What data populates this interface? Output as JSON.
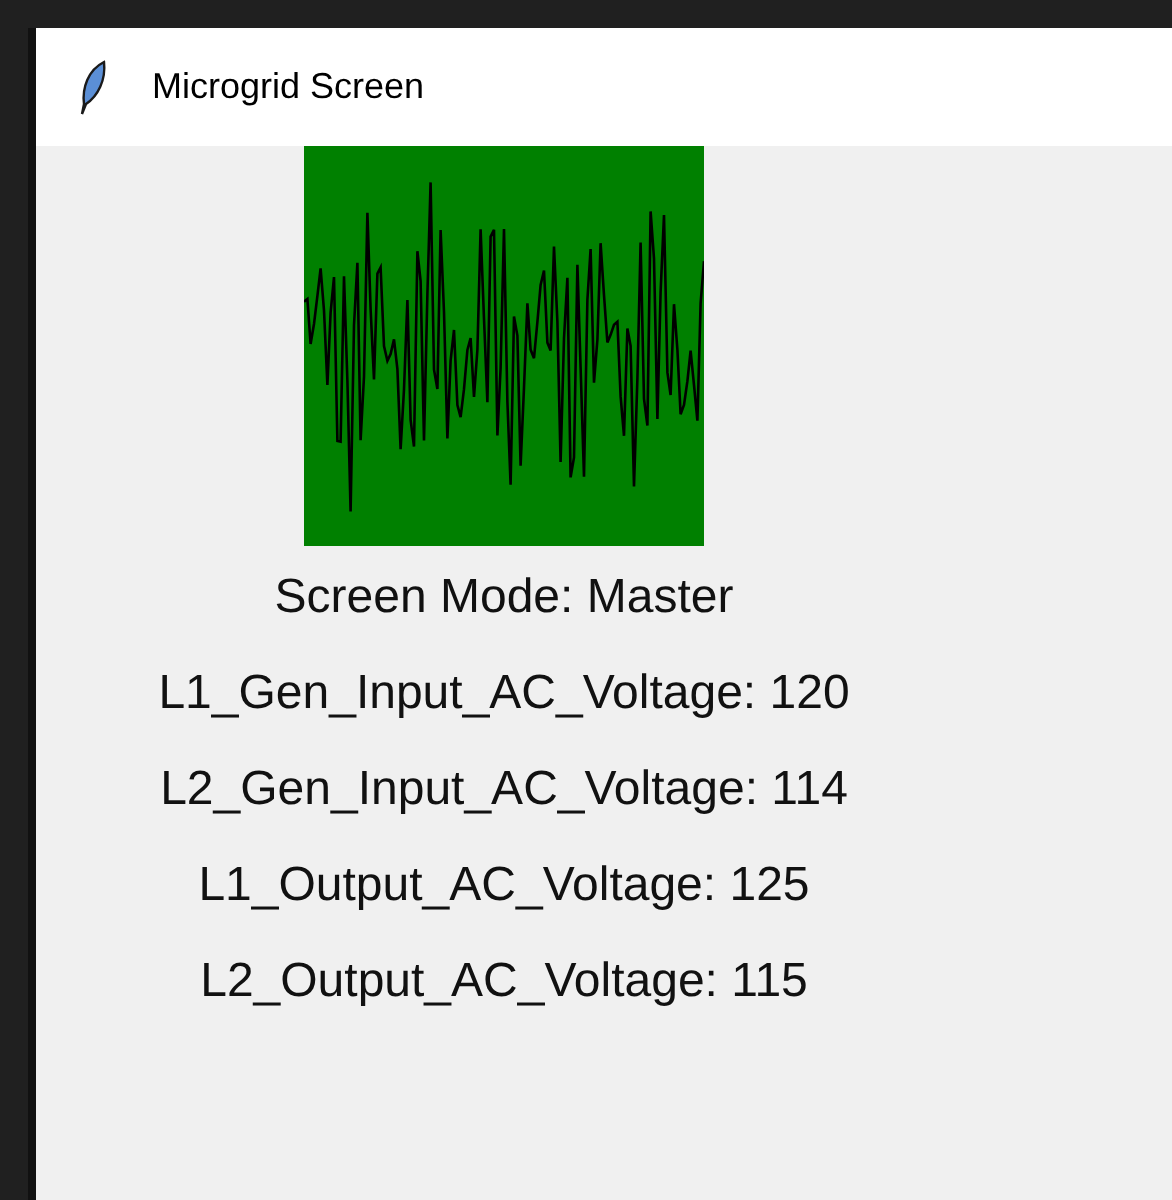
{
  "window": {
    "title": "Microgrid Screen"
  },
  "labels": [
    "Screen Mode: Master",
    "L1_Gen_Input_AC_Voltage: 120",
    "L2_Gen_Input_AC_Voltage: 114",
    "L1_Output_AC_Voltage: 125",
    "L2_Output_AC_Voltage: 115"
  ]
}
